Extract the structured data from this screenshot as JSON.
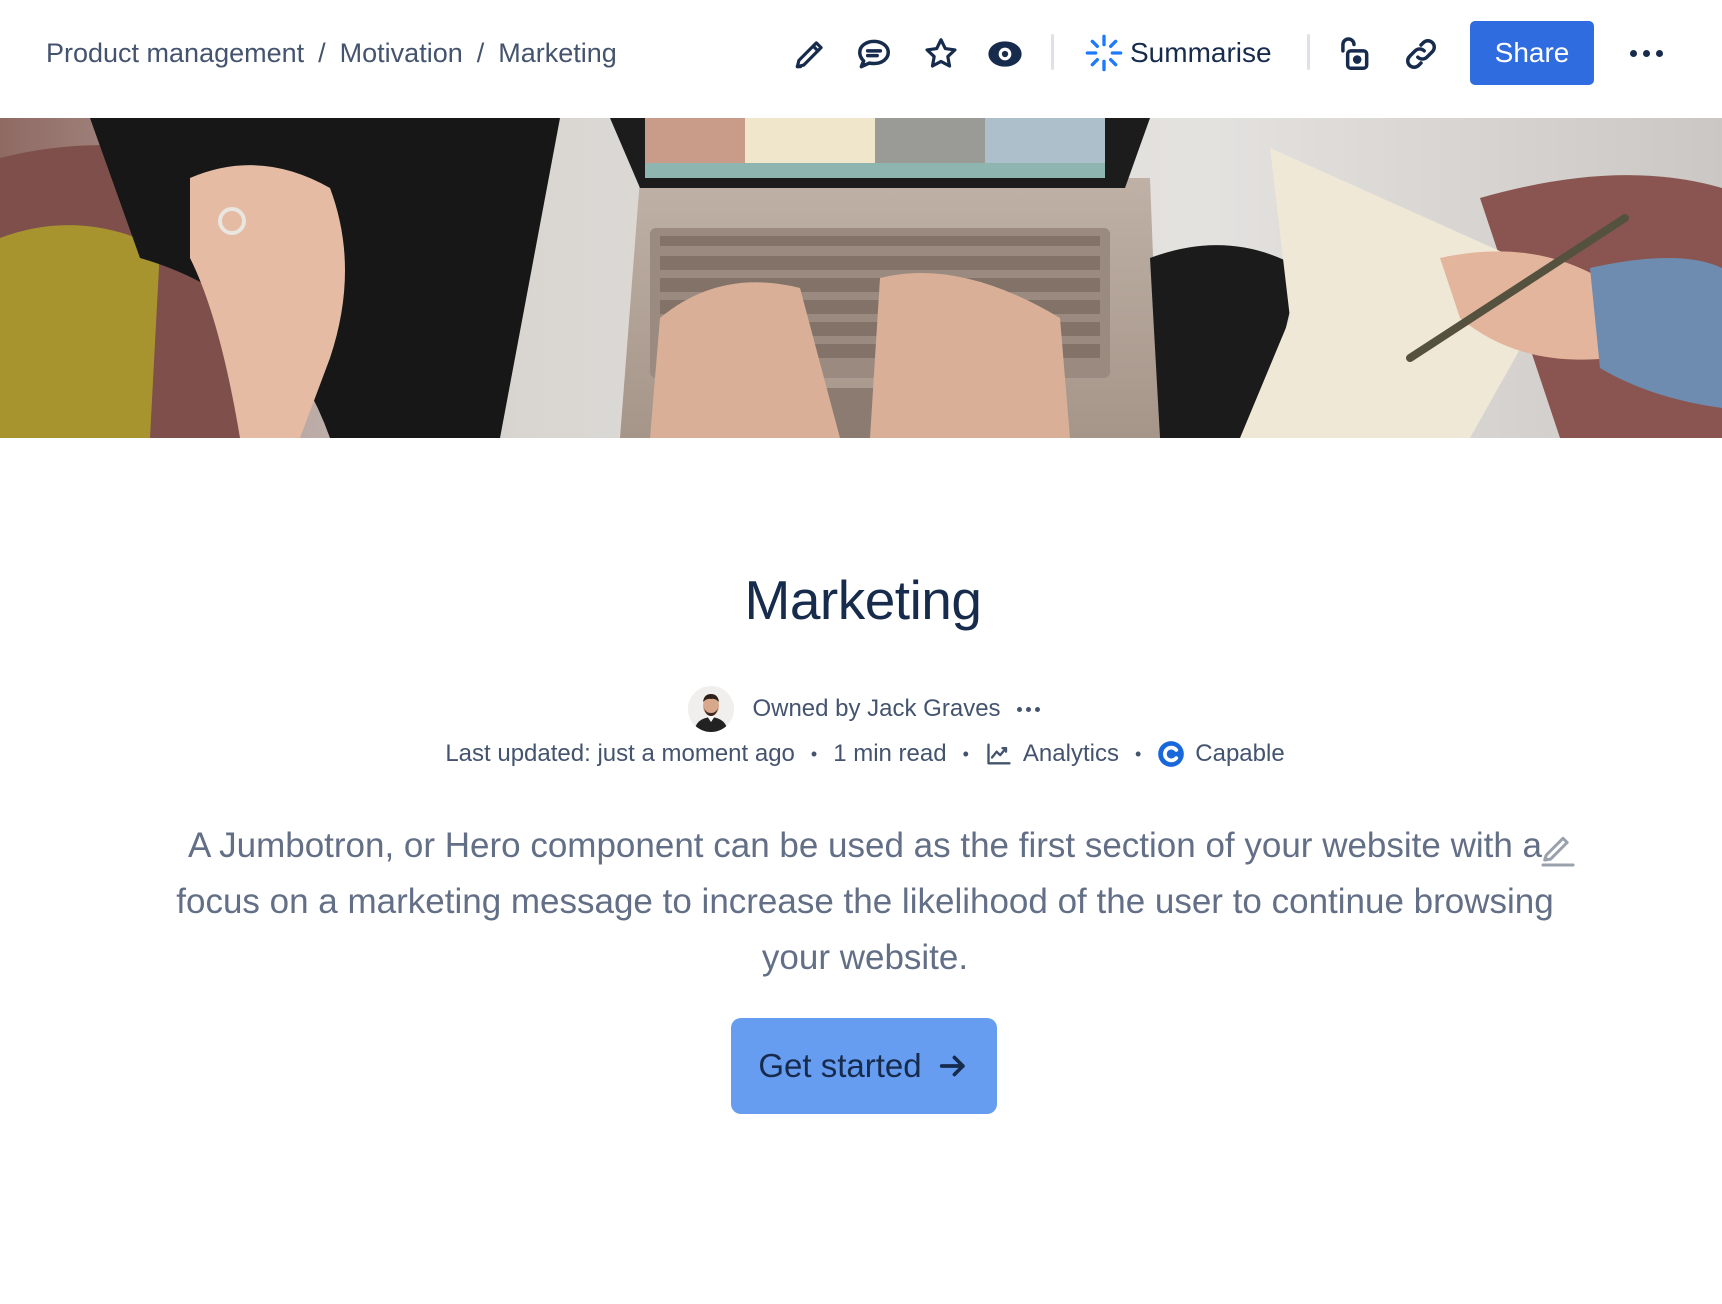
{
  "breadcrumb": {
    "items": [
      "Product management",
      "Motivation",
      "Marketing"
    ],
    "separator": "/"
  },
  "toolbar": {
    "icons": [
      "edit-icon",
      "comment-icon",
      "star-icon",
      "watch-icon",
      "restrictions-icon",
      "copy-link-icon"
    ],
    "summarise_label": "Summarise",
    "share_label": "Share",
    "more_icon": "more-horizontal-icon"
  },
  "page": {
    "title": "Marketing",
    "owner_text": "Owned by Jack Graves",
    "last_updated": "Last updated: just a moment ago",
    "read_time": "1 min read",
    "analytics_label": "Analytics",
    "capable_label": "Capable",
    "description": "A Jumbotron, or Hero component can be used as the first section of your website with a focus on a marketing message to increase the likelihood of the user to continue browsing your website.",
    "cta_label": "Get started"
  },
  "colors": {
    "accent": "#2f6ce0",
    "cta": "#669df1",
    "text": "#172b4d",
    "subtle_text": "#626f86"
  }
}
